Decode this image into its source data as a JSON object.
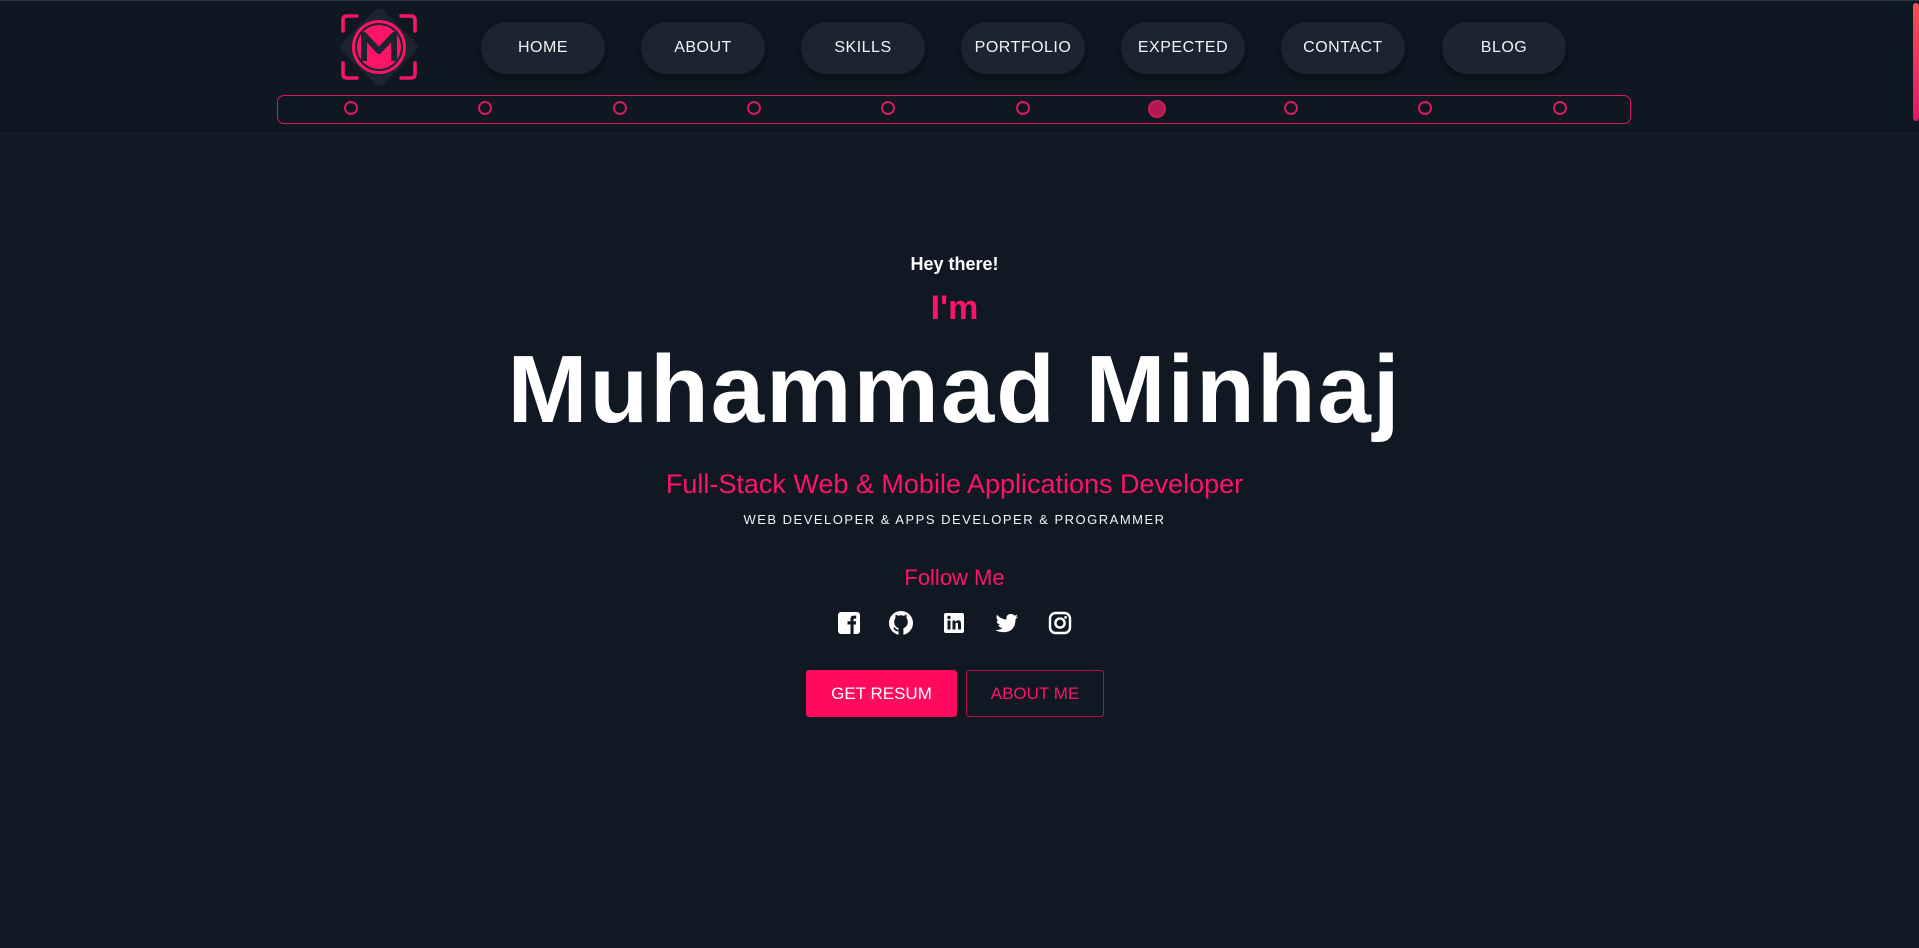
{
  "nav": {
    "logo_icon": "mm-monogram-logo-icon",
    "items": [
      {
        "label": "HOME"
      },
      {
        "label": "ABOUT"
      },
      {
        "label": "SKILLS"
      },
      {
        "label": "PORTFOLIO"
      },
      {
        "label": "EXPECTED"
      },
      {
        "label": "CONTACT"
      },
      {
        "label": "BLOG"
      }
    ]
  },
  "section_indicator": {
    "total": 10,
    "active_index": 6
  },
  "hero": {
    "greeting": "Hey there!",
    "intro": "I'm",
    "name": "Muhammad Minhaj",
    "role": "Full-Stack Web & Mobile Applications Developer",
    "subrole": "WEB DEVELOPER & APPS DEVELOPER & PROGRAMMER",
    "follow_label": "Follow Me",
    "social_icons": [
      "facebook-icon",
      "github-icon",
      "linkedin-icon",
      "twitter-icon",
      "instagram-icon"
    ],
    "primary_button": "GET RESUM",
    "secondary_button": "ABOUT ME"
  },
  "colors": {
    "background": "#101824",
    "accent": "#ff1366",
    "nav_button": "#1b2430",
    "text": "#ffffff"
  }
}
